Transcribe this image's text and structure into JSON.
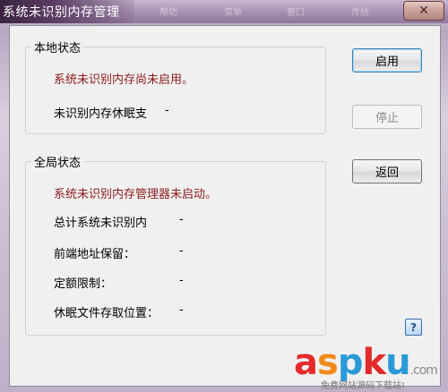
{
  "window": {
    "title": "系统未识别内存管理",
    "close_symbol": "✕",
    "ghost_tabs": [
      "帮助",
      "菜单",
      "窗口",
      "传统"
    ]
  },
  "local_status": {
    "label": "本地状态",
    "message": "系统未识别内存尚未启用。",
    "rows": [
      {
        "label": "未识别内存休眠支",
        "value": "-"
      }
    ],
    "enable_button": "启用",
    "stop_button": "停止"
  },
  "global_status": {
    "label": "全局状态",
    "message": "系统未识别内存管理器未启动。",
    "rows": [
      {
        "label": "总计系统未识别内",
        "value": "-"
      },
      {
        "label": "前端地址保留：",
        "value": "-"
      },
      {
        "label": "定额限制：",
        "value": "-"
      },
      {
        "label": "休眠文件存取位置：",
        "value": "-"
      }
    ],
    "back_button": "返回"
  },
  "help": {
    "symbol": "?"
  },
  "watermark": {
    "main": "aspku",
    "dot": ".com",
    "sub": "免费网站源码下载站!",
    "colors": {
      "a": "#e32b2b",
      "s": "#f08a1a",
      "p": "#2a9ad6",
      "k": "#e32b2b",
      "u": "#2a9ad6"
    }
  }
}
